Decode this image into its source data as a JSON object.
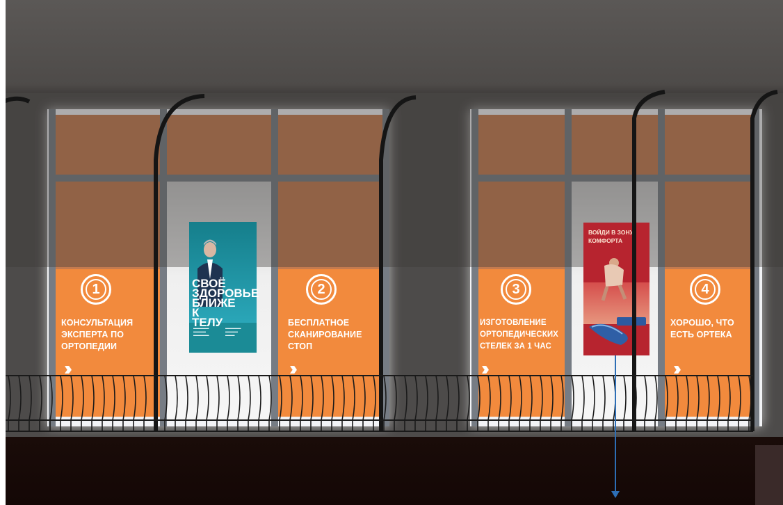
{
  "steps": [
    {
      "number": "1",
      "text": "КОНСУЛЬТАЦИЯ ЭКСПЕРТА ПО ОРТОПЕДИИ"
    },
    {
      "number": "2",
      "text": "БЕСПЛАТНОЕ СКАНИРОВАНИЕ СТОП"
    },
    {
      "number": "3",
      "text": "ИЗГОТОВЛЕНИЕ ОРТОПЕДИЧЕСКИХ СТЕЛЕК ЗА 1 ЧАС"
    },
    {
      "number": "4",
      "text": "ХОРОШО, ЧТО ЕСТЬ ОРТЕКА"
    }
  ],
  "poster_left": {
    "headline": "СВОЁ ЗДОРОВЬЕ БЛИЖЕ К ТЕЛУ",
    "icon": "portrait-man-icon"
  },
  "poster_right": {
    "headline": "ВОЙДИ В ЗОНУ КОМФОРТА",
    "icon": "runner-insole-icon"
  },
  "colors": {
    "orange": "#f28a3d",
    "teal": "#1b8b96",
    "red": "#b7242f",
    "arrow": "#2d6eb5"
  }
}
